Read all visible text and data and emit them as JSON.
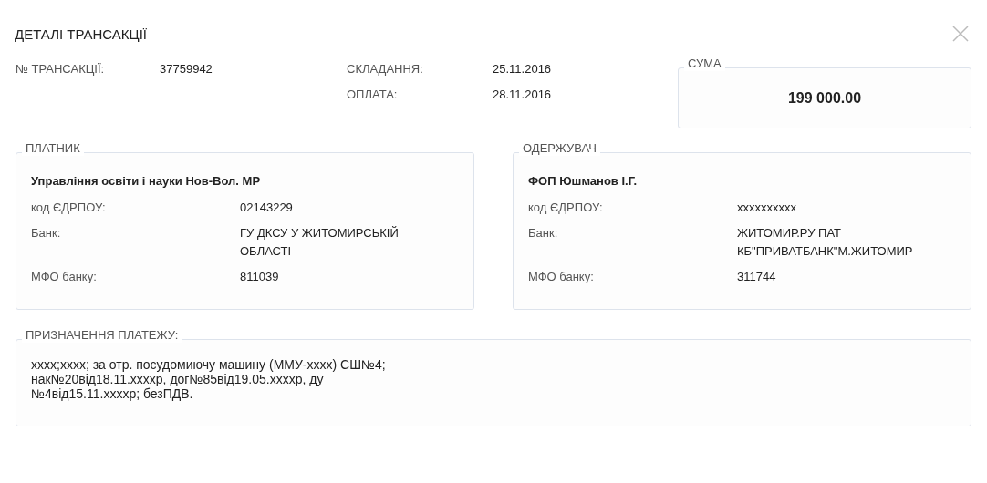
{
  "title": "ДЕТАЛІ ТРАНСАКЦІЇ",
  "transaction": {
    "label": "№ ТРАНСАКЦІЇ:",
    "value": "37759942"
  },
  "dates": [
    {
      "label": "СКЛАДАННЯ:",
      "value": "25.11.2016"
    },
    {
      "label": "ОПЛАТА:",
      "value": "28.11.2016"
    }
  ],
  "sum": {
    "legend": "СУМА",
    "value": "199 000.00"
  },
  "parties": [
    {
      "legend": "ПЛАТНИК",
      "name": "Управління освіти і науки Нов-Вол. МР",
      "fields": [
        {
          "label": "код ЄДРПОУ:",
          "value": "02143229"
        },
        {
          "label": "Банк:",
          "value": "ГУ ДКСУ У ЖИТОМИРСЬКІЙ ОБЛАСТІ"
        },
        {
          "label": "МФО банку:",
          "value": "811039"
        }
      ]
    },
    {
      "legend": "ОДЕРЖУВАЧ",
      "name": "ФОП Юшманов І.Г.",
      "fields": [
        {
          "label": "код ЄДРПОУ:",
          "value": "xxxxxxxxxx"
        },
        {
          "label": "Банк:",
          "value": "ЖИТОМИР.РУ ПАТ КБ\"ПРИВАТБАНК\"М.ЖИТОМИР"
        },
        {
          "label": "МФО банку:",
          "value": "311744"
        }
      ]
    }
  ],
  "purpose": {
    "legend": "ПРИЗНАЧЕННЯ ПЛАТЕЖУ:",
    "lines": [
      "xxxx;xxxx; за отр. посудомиючу машину (ММУ-xxxx) СШ№4;",
      "нак№20від18.11.xxxxр, дог№85від19.05.xxxxр, ду",
      "№4від15.11.xxxxр; безПДВ."
    ]
  }
}
